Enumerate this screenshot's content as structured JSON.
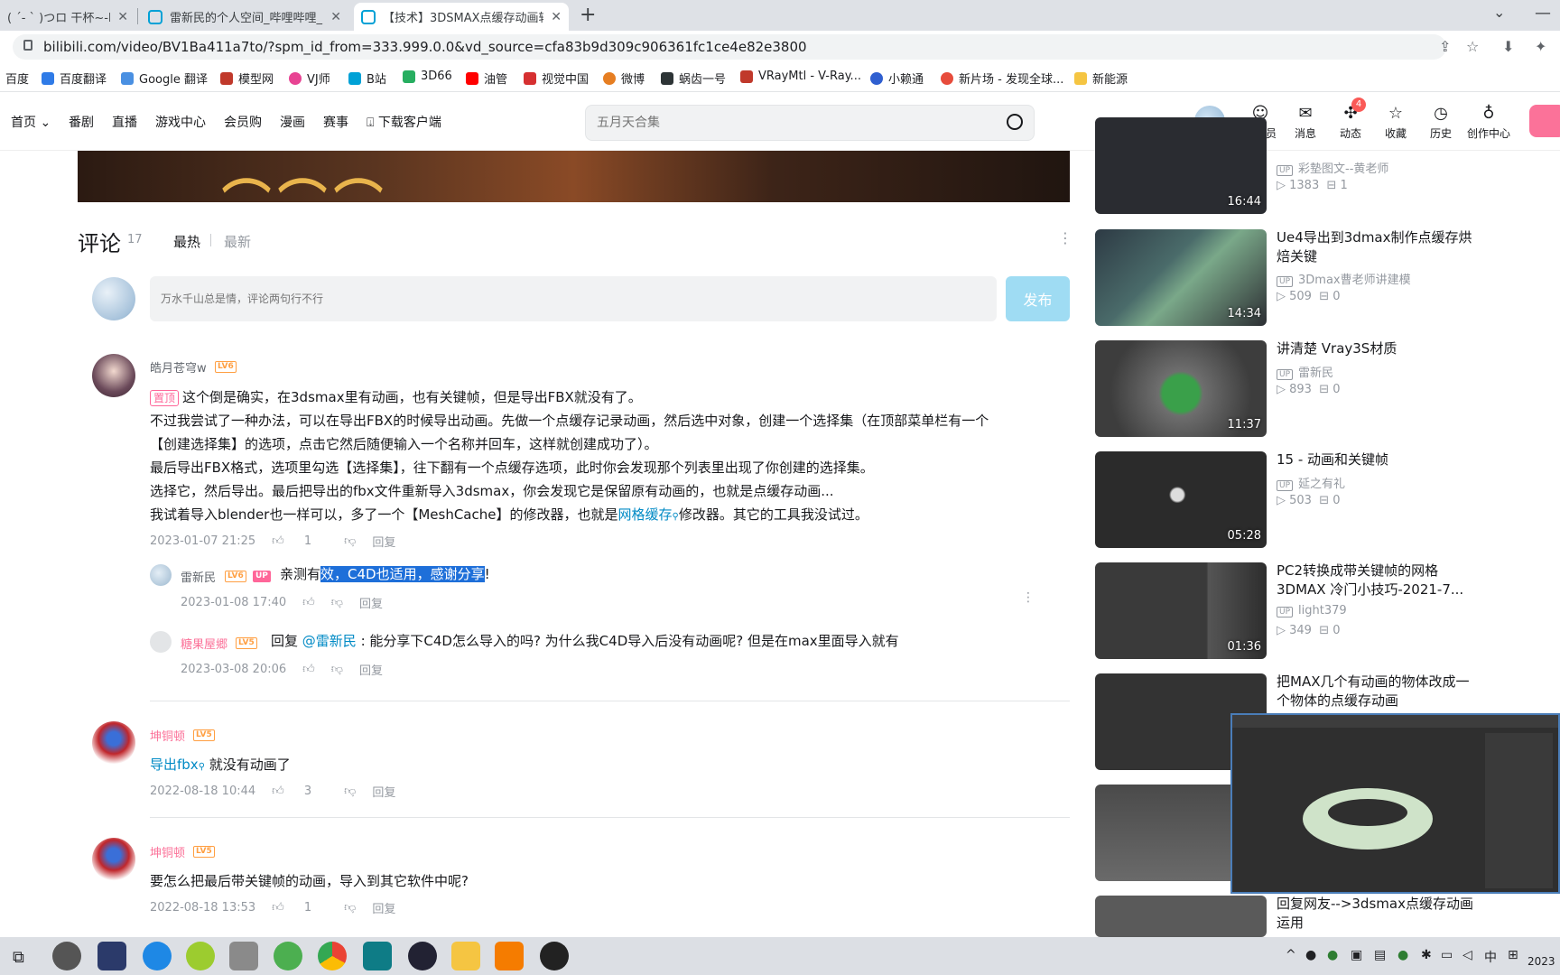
{
  "browser": {
    "tabs": [
      {
        "label": "( ´- ` )つロ 干杯~-bili"
      },
      {
        "label": "雷新民的个人空间_哔哩哔哩_bili"
      },
      {
        "label": "【技术】3DSMAX点缓存动画转"
      }
    ],
    "url": "bilibili.com/video/BV1Ba411a7to/?spm_id_from=333.999.0.0&vd_source=cfa83b9d309c906361fc1ce4e82e3800",
    "bookmarks": [
      "百度",
      "百度翻译",
      "Google 翻译",
      "模型网",
      "VJ师",
      "B站",
      "3D66",
      "油管",
      "视觉中国",
      "微博",
      "蜗齿一号",
      "VRayMtl - V-Ray...",
      "小赖通",
      "新片场 - 发现全球...",
      "新能源"
    ]
  },
  "header": {
    "nav": [
      "首页",
      "番剧",
      "直播",
      "游戏中心",
      "会员购",
      "漫画",
      "赛事",
      "下载客户端"
    ],
    "search_placeholder": "五月天合集",
    "icons": [
      {
        "label": "大会员",
        "icon": "vip-icon"
      },
      {
        "label": "消息",
        "icon": "message-icon"
      },
      {
        "label": "动态",
        "icon": "dynamic-icon"
      },
      {
        "label": "收藏",
        "icon": "favorite-icon"
      },
      {
        "label": "历史",
        "icon": "history-icon"
      },
      {
        "label": "创作中心",
        "icon": "creator-icon"
      }
    ],
    "badge": "4"
  },
  "comments_section": {
    "title": "评论",
    "count": "17",
    "sort_hot": "最热",
    "sort_new": "最新",
    "input_placeholder": "万水千山总是情，评论两句行不行",
    "submit": "发布"
  },
  "comments": [
    {
      "user": "皓月苍穹w",
      "level": "LV6",
      "pin": "置顶",
      "lines": [
        "这个倒是确实，在3dsmax里有动画，也有关键帧，但是导出FBX就没有了。",
        "不过我尝试了一种办法，可以在导出FBX的时候导出动画。先做一个点缓存记录动画，然后选中对象，创建一个选择集（在顶部菜单栏有一个",
        "【创建选择集】的选项，点击它然后随便输入一个名称并回车，这样就创建成功了）。",
        "最后导出FBX格式，选项里勾选【选择集】，往下翻有一个点缓存选项，此时你会发现那个列表里出现了你创建的选择集。",
        "选择它，然后导出。最后把导出的fbx文件重新导入3dsmax，你会发现它是保留原有动画的，也就是点缓存动画..."
      ],
      "last_pre": "我试着导入blender也一样可以，多了一个【MeshCache】的修改器，也就是",
      "last_link": "网格缓存",
      "last_post": "修改器。其它的工具我没试过。",
      "time": "2023-01-07 21:25",
      "likes": "1",
      "reply": "回复"
    },
    {
      "user": "雷新民",
      "level": "LV6",
      "up": "UP",
      "text_pre": "亲测有",
      "text_sel": "效，C4D也适用，感谢分享",
      "text_post": "!",
      "time": "2023-01-08 17:40",
      "reply": "回复"
    },
    {
      "user": "糖果屋郷",
      "level": "LV5",
      "text_pre": "回复 ",
      "mention": "@雷新民",
      "text_post": " : 能分享下C4D怎么导入的吗? 为什么我C4D导入后没有动画呢? 但是在max里面导入就有",
      "time": "2023-03-08 20:06",
      "reply": "回复"
    },
    {
      "user": "坤铜顿",
      "level": "LV5",
      "link": "导出fbx",
      "text_post": " 就没有动画了",
      "time": "2022-08-18 10:44",
      "likes": "3",
      "reply": "回复"
    },
    {
      "user": "坤铜顿",
      "level": "LV5",
      "text": "要怎么把最后带关键帧的动画，导入到其它软件中呢?",
      "time": "2022-08-18 13:53",
      "likes": "1",
      "reply": "回复"
    }
  ],
  "recommend": [
    {
      "up": "彩墊图文--黄老师",
      "plays": "1383",
      "danmaku": "1",
      "duration": "16:44"
    },
    {
      "title": "Ue4导出到3dmax制作点缓存烘焙关键",
      "up": "3Dmax曹老师讲建模",
      "plays": "509",
      "danmaku": "0",
      "duration": "14:34"
    },
    {
      "title": "讲清楚 Vray3S材质",
      "up": "雷新民",
      "plays": "893",
      "danmaku": "0",
      "duration": "11:37"
    },
    {
      "title": "15 - 动画和关键帧",
      "up": "延之有礼",
      "plays": "503",
      "danmaku": "0",
      "duration": "05:28"
    },
    {
      "title": "PC2转换成带关键帧的网格 3DMAX 冷门小技巧-2021-7...",
      "up": "light379",
      "plays": "349",
      "danmaku": "0",
      "duration": "01:36"
    },
    {
      "title": "把MAX几个有动画的物体改成一个物体的点缓存动画"
    },
    {
      "title": ""
    },
    {
      "title": "回复网友-->3dsmax点缓存动画运用"
    }
  ],
  "taskbar": {
    "ime": "中",
    "clock": "2023"
  }
}
